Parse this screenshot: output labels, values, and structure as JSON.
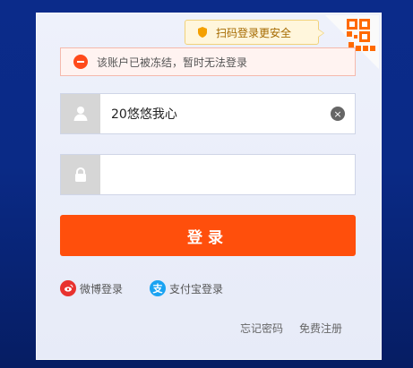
{
  "qr_tip": {
    "text": "扫码登录更安全",
    "icon": "shield-icon"
  },
  "error": {
    "text": "该账户已被冻结，暂时无法登录",
    "icon": "error-icon"
  },
  "username": {
    "value": "20悠悠我心",
    "icon": "user-icon",
    "clear_icon": "clear-icon"
  },
  "password": {
    "value": "",
    "icon": "lock-icon"
  },
  "login_button": {
    "label": "登录"
  },
  "social_login": {
    "weibo_label": "微博登录",
    "alipay_label": "支付宝登录",
    "alipay_glyph": "支"
  },
  "links": {
    "forgot_password": "忘记密码",
    "register": "免费注册"
  },
  "colors": {
    "primary_orange": "#ff4f0c",
    "error_red": "#ff4a1b",
    "weibo_red": "#e8322f",
    "alipay_blue": "#1aa3f2"
  }
}
